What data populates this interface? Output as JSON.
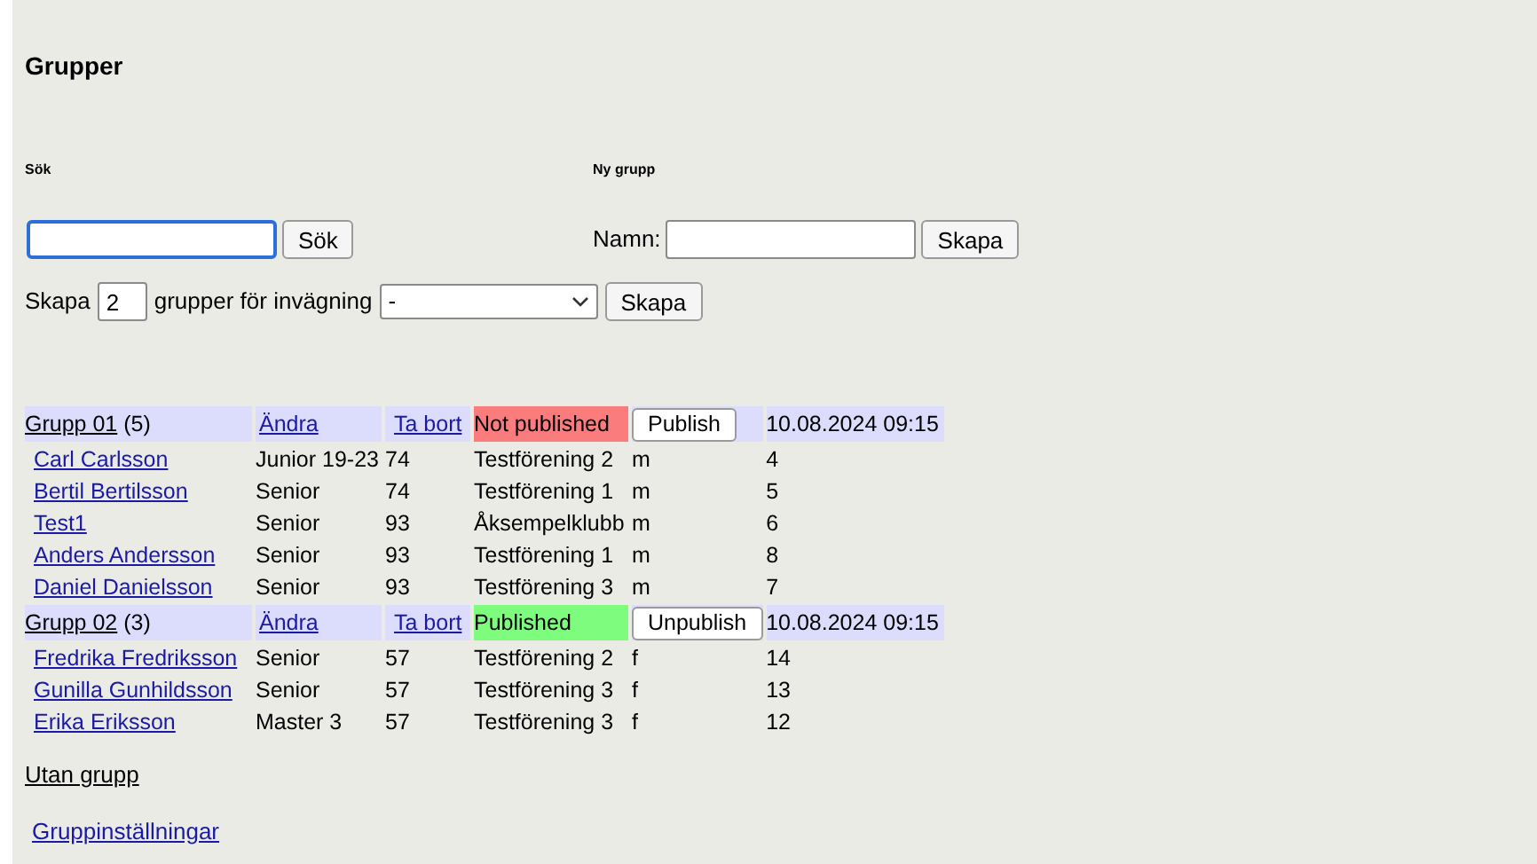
{
  "title": "Grupper",
  "search": {
    "heading": "Sök",
    "button": "Sök"
  },
  "new_group": {
    "heading": "Ny grupp",
    "label": "Namn:",
    "button": "Skapa"
  },
  "bulk_create": {
    "prefix": "Skapa",
    "count": "2",
    "middle": "grupper för invägning",
    "select_value": "-",
    "button": "Skapa"
  },
  "groups": [
    {
      "name": "Grupp 01",
      "count": "(5)",
      "edit": "Ändra",
      "delete": "Ta bort",
      "status": "Not published",
      "published": false,
      "toggle": "Publish",
      "date": "10.08.2024 09:15",
      "members": [
        {
          "name": "Carl Carlsson",
          "class": "Junior 19-23",
          "weight": "74",
          "club": "Testförening 2",
          "gender": "m",
          "number": "4"
        },
        {
          "name": "Bertil Bertilsson",
          "class": "Senior",
          "weight": "74",
          "club": "Testförening 1",
          "gender": "m",
          "number": "5"
        },
        {
          "name": "Test1",
          "class": "Senior",
          "weight": "93",
          "club": "Åksempelklubb",
          "gender": "m",
          "number": "6"
        },
        {
          "name": "Anders Andersson",
          "class": "Senior",
          "weight": "93",
          "club": "Testförening 1",
          "gender": "m",
          "number": "8"
        },
        {
          "name": "Daniel Danielsson",
          "class": "Senior",
          "weight": "93",
          "club": "Testförening 3",
          "gender": "m",
          "number": "7"
        }
      ]
    },
    {
      "name": "Grupp 02",
      "count": "(3)",
      "edit": "Ändra",
      "delete": "Ta bort",
      "status": "Published",
      "published": true,
      "toggle": "Unpublish",
      "date": "10.08.2024 09:15",
      "members": [
        {
          "name": "Fredrika Fredriksson",
          "class": "Senior",
          "weight": "57",
          "club": "Testförening 2",
          "gender": "f",
          "number": "14"
        },
        {
          "name": "Gunilla Gunhildsson",
          "class": "Senior",
          "weight": "57",
          "club": "Testförening 3",
          "gender": "f",
          "number": "13"
        },
        {
          "name": "Erika Eriksson",
          "class": "Master 3",
          "weight": "57",
          "club": "Testförening 3",
          "gender": "f",
          "number": "12"
        }
      ]
    }
  ],
  "links": [
    "Utan grupp",
    "Gruppinställningar"
  ]
}
